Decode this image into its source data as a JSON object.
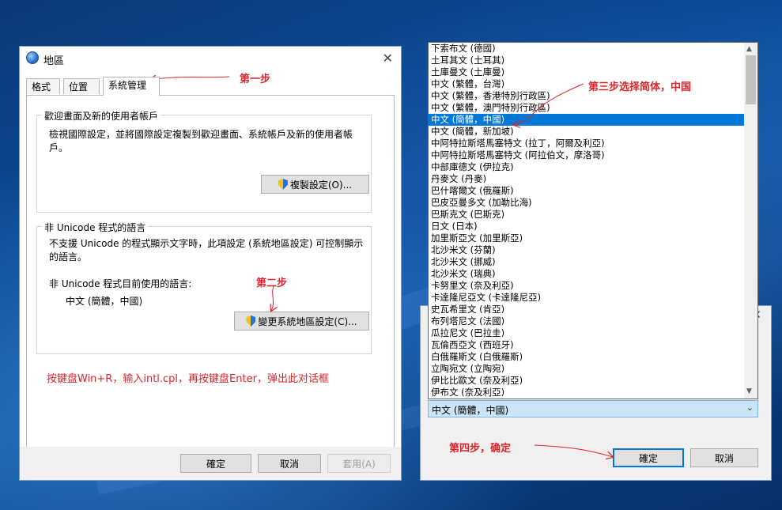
{
  "colors": {
    "accent": "#0078d7",
    "annotation": "#d9262c"
  },
  "region_dialog": {
    "title": "地區",
    "close_icon": "close-icon",
    "tabs": [
      {
        "label": "格式"
      },
      {
        "label": "位置"
      },
      {
        "label": "系統管理"
      }
    ],
    "welcome_group": {
      "title": "歡迎畫面及新的使用者帳戶",
      "description": "檢視國際設定，並將國際設定複製到歡迎畫面、系統帳戶及新的使用者帳戶。",
      "copy_button": "複製設定(O)..."
    },
    "unicode_group": {
      "title": "非 Unicode 程式的語言",
      "description": "不支援 Unicode 的程式顯示文字時，此項設定 (系統地區設定) 可控制顯示的語言。",
      "current_label": "非 Unicode 程式目前使用的語言:",
      "current_value": "中文 (簡體，中國)",
      "change_button": "變更系統地區設定(C)..."
    },
    "footer": {
      "ok": "確定",
      "cancel": "取消",
      "apply": "套用(A)"
    }
  },
  "locale_dialog": {
    "selected": "中文 (簡體，中國)",
    "ok": "確定",
    "cancel": "取消",
    "options": [
      "下索布文 (德國)",
      "土耳其文 (土耳其)",
      "土庫曼文 (土庫曼)",
      "中文 (繁體，台灣)",
      "中文 (繁體，香港特別行政區)",
      "中文 (繁體，澳門特別行政區)",
      "中文 (簡體，中國)",
      "中文 (簡體，新加坡)",
      "中阿特拉斯塔馬塞特文 (拉丁，阿爾及利亞)",
      "中阿特拉斯塔馬塞特文 (阿拉伯文，摩洛哥)",
      "中部庫德文 (伊拉克)",
      "丹麥文 (丹麥)",
      "巴什喀爾文 (俄羅斯)",
      "巴皮亞曼多文 (加勒比海)",
      "巴斯克文 (巴斯克)",
      "日文 (日本)",
      "加里斯亞文 (加里斯亞)",
      "北沙米文 (芬蘭)",
      "北沙米文 (挪威)",
      "北沙米文 (瑞典)",
      "卡努里文 (奈及利亞)",
      "卡達隆尼亞文 (卡達隆尼亞)",
      "史瓦希里文 (肯亞)",
      "布列塔尼文 (法國)",
      "瓜拉尼文 (巴拉圭)",
      "瓦倫西亞文 (西班牙)",
      "白俄羅斯文 (白俄羅斯)",
      "立陶宛文 (立陶宛)",
      "伊比比歐文 (奈及利亞)",
      "伊布文 (奈及利亞)"
    ],
    "selected_index": 6
  },
  "annotations": {
    "step1": "第一步",
    "step2": "第二步",
    "step3": "第三步选择简体，中国",
    "step4": "第四步，确定",
    "instructions": "按键盘Win+R，输入intl.cpl，再按键盘Enter，弹出此对话框"
  }
}
